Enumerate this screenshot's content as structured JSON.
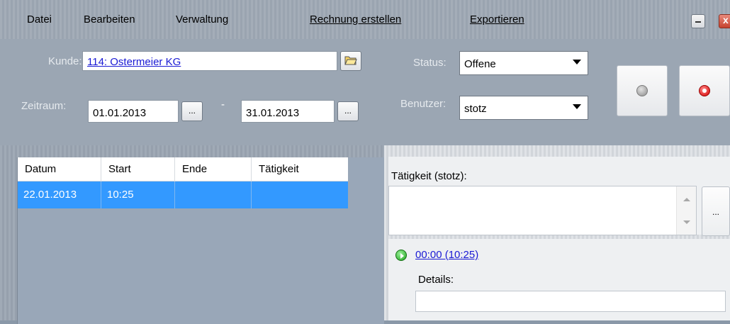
{
  "menu": {
    "datei": "Datei",
    "bearbeiten": "Bearbeiten",
    "verwaltung": "Verwaltung",
    "rechnung": "Rechnung erstellen",
    "exportieren": "Exportieren"
  },
  "filters": {
    "kunde_label": "Kunde:",
    "kunde_value": "114: Ostermeier KG",
    "zeitraum_label": "Zeitraum:",
    "date_from": "01.01.2013",
    "date_sep": "-",
    "date_to": "31.01.2013",
    "picker_label": "...",
    "status_label": "Status:",
    "status_value": "Offene",
    "benutzer_label": "Benutzer:",
    "benutzer_value": "stotz"
  },
  "grid": {
    "columns": [
      "Datum",
      "Start",
      "Ende",
      "Tätigkeit"
    ],
    "rows": [
      {
        "datum": "22.01.2013",
        "start": "10:25",
        "ende": "",
        "taetigkeit": ""
      }
    ]
  },
  "detail": {
    "taetigkeit_label": "Tätigkeit (stotz):",
    "memo_button": "...",
    "time_link": "00:00 (10:25)",
    "details_label": "Details:"
  }
}
